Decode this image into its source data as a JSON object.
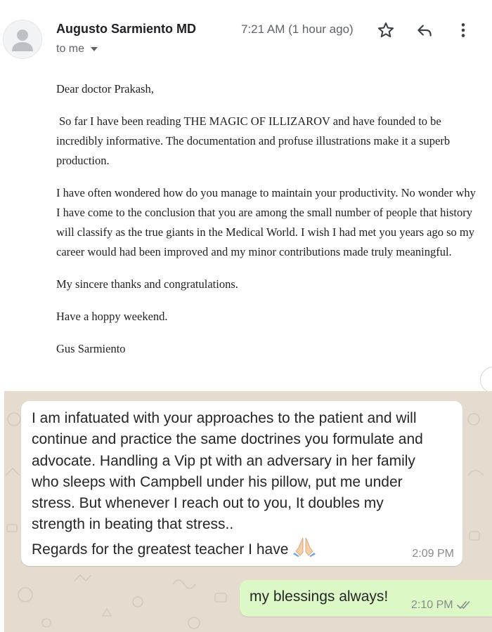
{
  "email": {
    "sender_name": "Augusto Sarmiento MD",
    "recipient_label": "to me",
    "time": "7:21 AM (1 hour ago)",
    "icons": {
      "avatar": "person-avatar-icon",
      "recipient_dropdown": "caret-down-icon",
      "star": "star-outline-icon",
      "reply": "reply-arrow-icon",
      "more": "more-vertical-icon"
    },
    "body": {
      "greeting": "Dear doctor Prakash,",
      "paragraph_1": "So far I have been reading THE MAGIC OF ILLIZAROV and have founded to be incredibly informative. The documentation and profuse illustrations make it a superb production.",
      "paragraph_2": "I have often wondered how do you manage to maintain your productivity. No wonder why I have come to the conclusion that you are among the small number of people that history will classify as the true giants in the Medical World. I wish I had met you years ago so my career would had been improved and my minor contributions made truly meaningful.",
      "paragraph_3": "My sincere thanks and congratulations.",
      "paragraph_4": "Have a hoppy weekend.",
      "signature": "Gus Sarmiento"
    }
  },
  "chat": {
    "incoming": {
      "lines": [
        "I am infatuated with your approaches to the patient and will",
        "continue and practice the same doctrines you formulate and",
        "advocate. Handling a Vip pt with an adversary in her family",
        "who sleeps with Campbell under his pillow, put me under",
        "stress. But whenever I reach out to you, It doubles my",
        "strength in beating that stress..",
        "Regards for the greatest teacher I have"
      ],
      "emoji": "folded-hands-icon",
      "time": "2:09 PM"
    },
    "outgoing": {
      "text": "my blessings always!",
      "time": "2:10 PM",
      "status_icon": "double-check-icon"
    }
  },
  "colors": {
    "chat_background": "#e5dccf",
    "incoming_bubble": "#ffffff",
    "outgoing_bubble": "#dcf8c6",
    "secondary_text": "#5f6368"
  }
}
